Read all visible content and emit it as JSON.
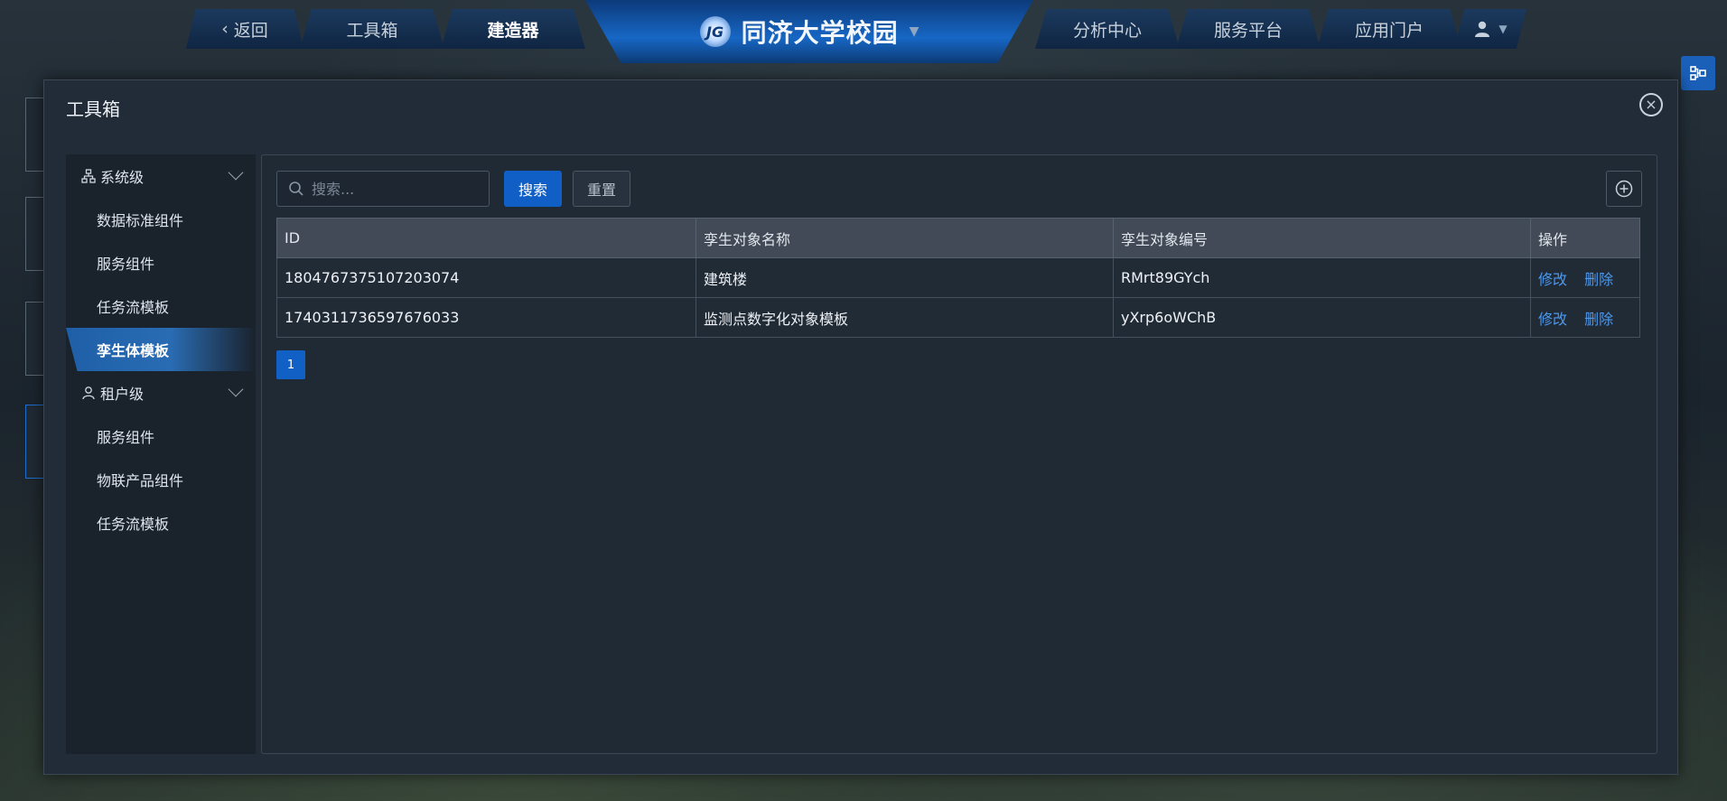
{
  "nav": {
    "back_label": "返回",
    "toolbox_label": "工具箱",
    "builder_label": "建造器",
    "center_logo_text": "JG",
    "center_title": "同济大学校园",
    "analysis_label": "分析中心",
    "service_label": "服务平台",
    "portal_label": "应用门户"
  },
  "modal": {
    "title": "工具箱"
  },
  "sidebar": {
    "groups": [
      {
        "label": "系统级",
        "items": [
          "数据标准组件",
          "服务组件",
          "任务流模板",
          "孪生体模板"
        ]
      },
      {
        "label": "租户级",
        "items": [
          "服务组件",
          "物联产品组件",
          "任务流模板"
        ]
      }
    ],
    "active_item": "孪生体模板"
  },
  "toolbar": {
    "search_placeholder": "搜索...",
    "search_value": "",
    "search_button": "搜索",
    "reset_button": "重置"
  },
  "table": {
    "headers": [
      "ID",
      "孪生对象名称",
      "孪生对象编号",
      "操作"
    ],
    "rows": [
      {
        "id": "1804767375107203074",
        "name": "建筑楼",
        "code": "RMrt89GYch",
        "edit": "修改",
        "delete": "删除"
      },
      {
        "id": "1740311736597676033",
        "name": "监测点数字化对象模板",
        "code": "yXrp6oWChB",
        "edit": "修改",
        "delete": "删除"
      }
    ]
  },
  "pagination": {
    "current_page": "1"
  },
  "colors": {
    "accent": "#0f5fc7",
    "link": "#4c98ee",
    "panel_bg": "#202a35"
  }
}
